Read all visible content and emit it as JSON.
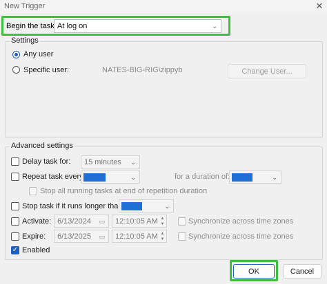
{
  "window": {
    "title": "New Trigger",
    "close_glyph": "✕"
  },
  "begin": {
    "label": "Begin the task:",
    "value": "At log on"
  },
  "settings": {
    "title": "Settings",
    "any_user": "Any user",
    "specific_user": "Specific user:",
    "user_value": "NATES-BIG-RIG\\zippyb",
    "change_user": "Change User..."
  },
  "advanced": {
    "title": "Advanced settings",
    "delay_label": "Delay task for:",
    "delay_value": "15 minutes",
    "repeat_label": "Repeat task every:",
    "duration_label": "for a duration of:",
    "stop_running_label": "Stop all running tasks at end of repetition duration",
    "stop_longer_label": "Stop task if it runs longer than:",
    "activate_label": "Activate:",
    "activate_date": "6/13/2024",
    "activate_time": "12:10:05 AM",
    "activate_sync": "Synchronize across time zones",
    "expire_label": "Expire:",
    "expire_date": "6/13/2025",
    "expire_time": "12:10:05 AM",
    "expire_sync": "Synchronize across time zones",
    "enabled_label": "Enabled"
  },
  "footer": {
    "ok": "OK",
    "cancel": "Cancel"
  },
  "colors": {
    "highlight": "#3fbf3f",
    "accent": "#1f5fbf",
    "selection": "#1f6fd6"
  }
}
